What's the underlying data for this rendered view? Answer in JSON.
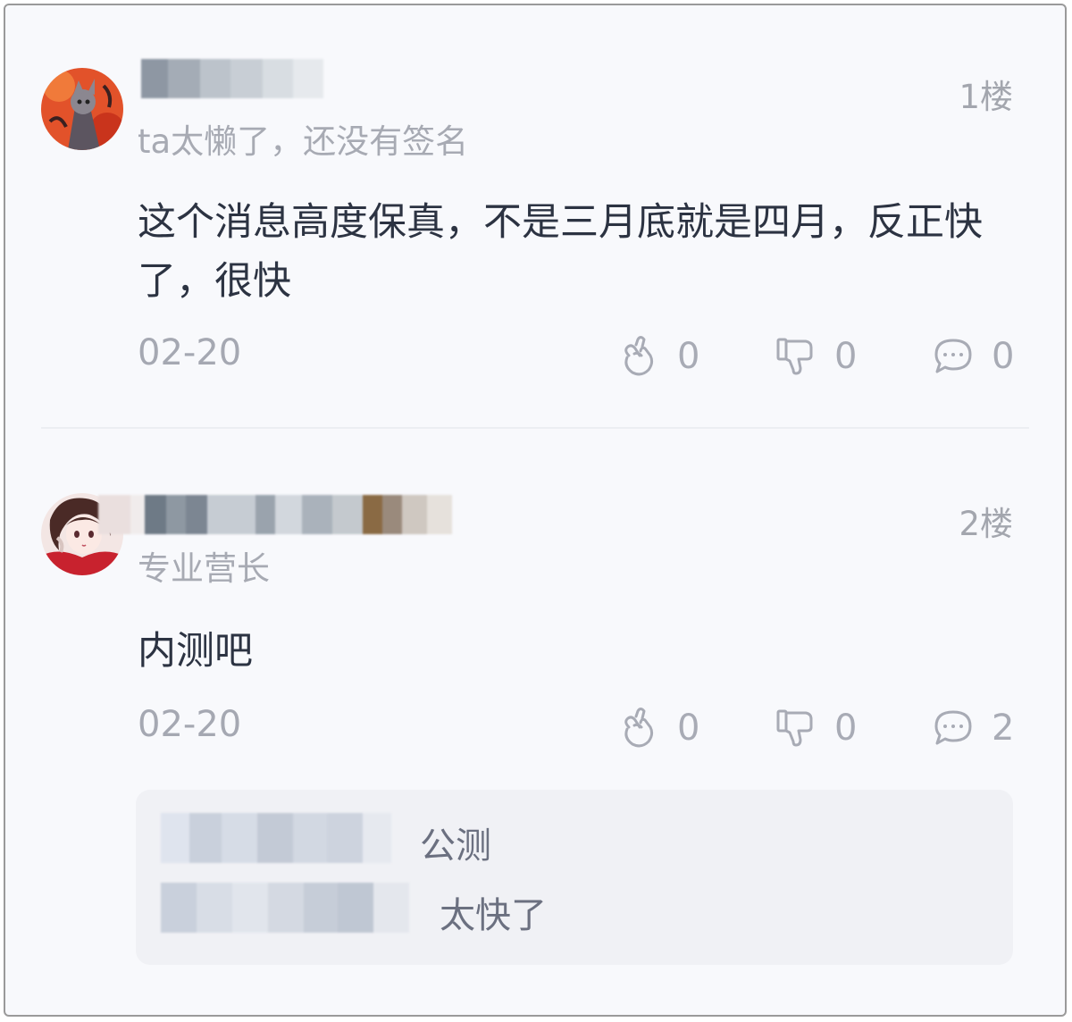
{
  "posts": [
    {
      "floor": "1楼",
      "subtitle": "ta太懒了，还没有签名",
      "content": "这个消息高度保真，不是三月底就是四月，反正快了，很快",
      "date": "02-20",
      "likes": "0",
      "dislikes": "0",
      "comments": "0"
    },
    {
      "floor": "2楼",
      "subtitle": "专业营长",
      "content": "内测吧",
      "date": "02-20",
      "likes": "0",
      "dislikes": "0",
      "comments": "2",
      "replies": [
        {
          "text": "公测"
        },
        {
          "text": "太快了"
        }
      ]
    }
  ],
  "icons": {
    "like": "finger-heart-icon",
    "dislike": "thumbs-down-icon",
    "comment": "comment-bubble-icon"
  },
  "colors": {
    "content_text": "#2c3342",
    "muted_text": "#a7aab3",
    "reply_bg": "#f0f1f5"
  }
}
